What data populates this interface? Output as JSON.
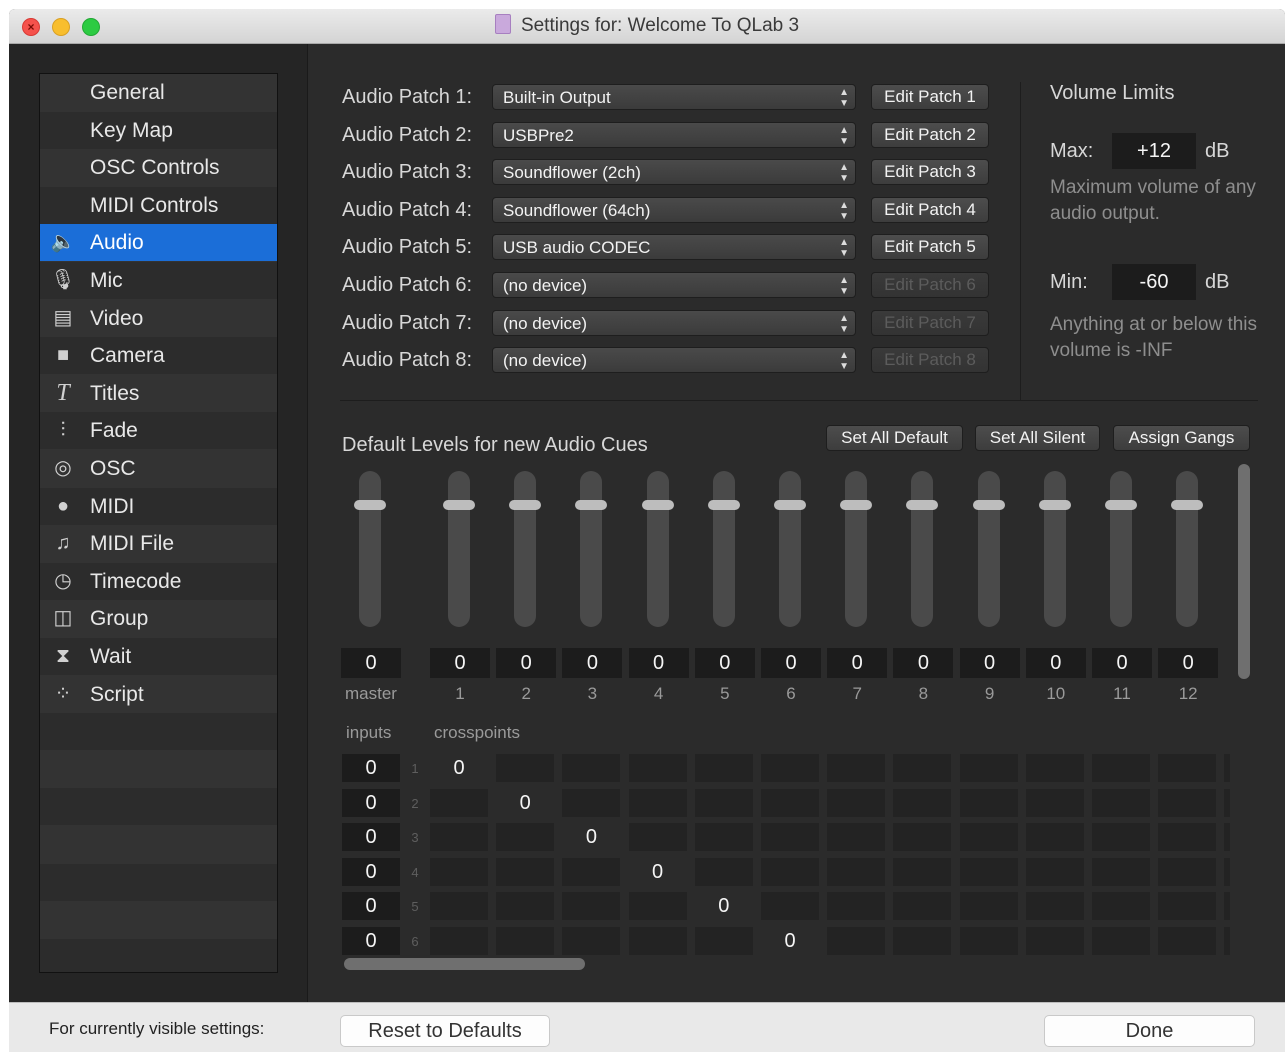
{
  "window": {
    "title": "Settings for: Welcome To QLab 3"
  },
  "sidebar": {
    "items": [
      {
        "label": "General",
        "icon": ""
      },
      {
        "label": "Key Map",
        "icon": ""
      },
      {
        "label": "OSC Controls",
        "icon": ""
      },
      {
        "label": "MIDI Controls",
        "icon": ""
      },
      {
        "label": "Audio",
        "icon": "speaker-icon",
        "selected": true
      },
      {
        "label": "Mic",
        "icon": "microphone-icon"
      },
      {
        "label": "Video",
        "icon": "film-icon"
      },
      {
        "label": "Camera",
        "icon": "camera-icon"
      },
      {
        "label": "Titles",
        "icon": "titles-icon"
      },
      {
        "label": "Fade",
        "icon": "fader-icon"
      },
      {
        "label": "OSC",
        "icon": "osc-icon"
      },
      {
        "label": "MIDI",
        "icon": "midi-icon"
      },
      {
        "label": "MIDI File",
        "icon": "music-note-icon"
      },
      {
        "label": "Timecode",
        "icon": "clock-icon"
      },
      {
        "label": "Group",
        "icon": "group-icon"
      },
      {
        "label": "Wait",
        "icon": "hourglass-icon"
      },
      {
        "label": "Script",
        "icon": "script-icon"
      }
    ]
  },
  "audio_patches": [
    {
      "label": "Audio Patch 1:",
      "device": "Built-in Output",
      "edit": "Edit Patch 1",
      "enabled": true
    },
    {
      "label": "Audio Patch 2:",
      "device": "USBPre2",
      "edit": "Edit Patch 2",
      "enabled": true
    },
    {
      "label": "Audio Patch 3:",
      "device": "Soundflower (2ch)",
      "edit": "Edit Patch 3",
      "enabled": true
    },
    {
      "label": "Audio Patch 4:",
      "device": "Soundflower (64ch)",
      "edit": "Edit Patch 4",
      "enabled": true
    },
    {
      "label": "Audio Patch 5:",
      "device": "USB audio CODEC",
      "edit": "Edit Patch 5",
      "enabled": true
    },
    {
      "label": "Audio Patch 6:",
      "device": "(no device)",
      "edit": "Edit Patch 6",
      "enabled": false
    },
    {
      "label": "Audio Patch 7:",
      "device": "(no device)",
      "edit": "Edit Patch 7",
      "enabled": false
    },
    {
      "label": "Audio Patch 8:",
      "device": "(no device)",
      "edit": "Edit Patch 8",
      "enabled": false
    }
  ],
  "volume_limits": {
    "title": "Volume Limits",
    "max_label": "Max:",
    "max_value": "+12",
    "max_unit": "dB",
    "max_help": "Maximum volume of any audio output.",
    "min_label": "Min:",
    "min_value": "-60",
    "min_unit": "dB",
    "min_help": "Anything at or below this volume is -INF"
  },
  "levels": {
    "title": "Default Levels for new Audio Cues",
    "set_all_default": "Set All Default",
    "set_all_silent": "Set All Silent",
    "assign_gangs": "Assign Gangs",
    "fader_level_fraction": 0.8,
    "faders": [
      {
        "label": "master",
        "value": "0"
      },
      {
        "label": "1",
        "value": "0"
      },
      {
        "label": "2",
        "value": "0"
      },
      {
        "label": "3",
        "value": "0"
      },
      {
        "label": "4",
        "value": "0"
      },
      {
        "label": "5",
        "value": "0"
      },
      {
        "label": "6",
        "value": "0"
      },
      {
        "label": "7",
        "value": "0"
      },
      {
        "label": "8",
        "value": "0"
      },
      {
        "label": "9",
        "value": "0"
      },
      {
        "label": "10",
        "value": "0"
      },
      {
        "label": "11",
        "value": "0"
      },
      {
        "label": "12",
        "value": "0"
      }
    ],
    "inputs_label": "inputs",
    "crosspoints_label": "crosspoints",
    "input_rows": [
      {
        "num": "1",
        "input": "0",
        "crosspoint_col": 1,
        "crosspoint": "0"
      },
      {
        "num": "2",
        "input": "0",
        "crosspoint_col": 2,
        "crosspoint": "0"
      },
      {
        "num": "3",
        "input": "0",
        "crosspoint_col": 3,
        "crosspoint": "0"
      },
      {
        "num": "4",
        "input": "0",
        "crosspoint_col": 4,
        "crosspoint": "0"
      },
      {
        "num": "5",
        "input": "0",
        "crosspoint_col": 5,
        "crosspoint": "0"
      },
      {
        "num": "6",
        "input": "0",
        "crosspoint_col": 6,
        "crosspoint": "0"
      }
    ]
  },
  "footer": {
    "label": "For currently visible settings:",
    "reset": "Reset to Defaults",
    "done": "Done"
  }
}
